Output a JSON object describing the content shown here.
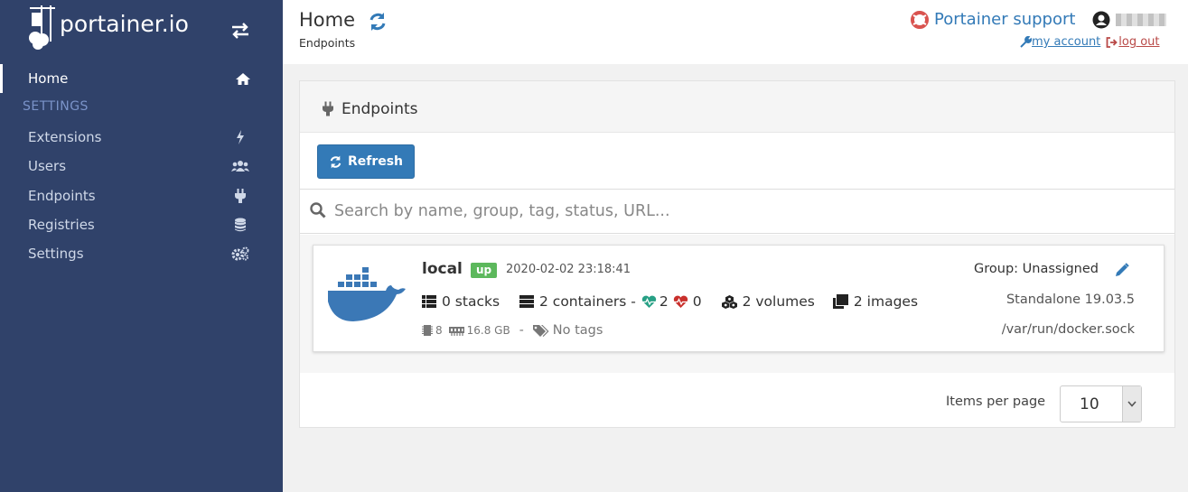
{
  "sidebar": {
    "brand": "portainer.io",
    "items": [
      {
        "label": "Home",
        "icon": "home-icon"
      },
      {
        "label": "Extensions",
        "icon": "bolt-icon"
      },
      {
        "label": "Users",
        "icon": "users-icon"
      },
      {
        "label": "Endpoints",
        "icon": "plug-icon"
      },
      {
        "label": "Registries",
        "icon": "database-icon"
      },
      {
        "label": "Settings",
        "icon": "cogs-icon"
      }
    ],
    "section_label": "SETTINGS"
  },
  "header": {
    "title": "Home",
    "breadcrumb": "Endpoints",
    "support_label": "Portainer support",
    "my_account_label": "my account",
    "logout_label": "log out"
  },
  "panel": {
    "title": "Endpoints",
    "refresh_label": "Refresh",
    "search_placeholder": "Search by name, group, tag, status, URL...",
    "endpoint": {
      "name": "local",
      "status": "up",
      "date": "2020-02-02 23:18:41",
      "stacks": "0 stacks",
      "containers": "2 containers -",
      "healthy": "2",
      "unhealthy": "0",
      "volumes": "2 volumes",
      "images": "2 images",
      "cpus": "8",
      "memory": "16.8 GB",
      "sep": "-",
      "tags": "No tags",
      "group": "Group: Unassigned",
      "version": "Standalone 19.03.5",
      "url": "/var/run/docker.sock"
    },
    "items_per_page_label": "Items per page",
    "items_per_page_value": "10"
  },
  "colors": {
    "sidebar_bg": "#30426a",
    "primary": "#337ab7",
    "status_up": "#5cb85c",
    "heart_healthy": "#27a085",
    "heart_unhealthy": "#c9302c",
    "support_icon": "#d9534f"
  }
}
